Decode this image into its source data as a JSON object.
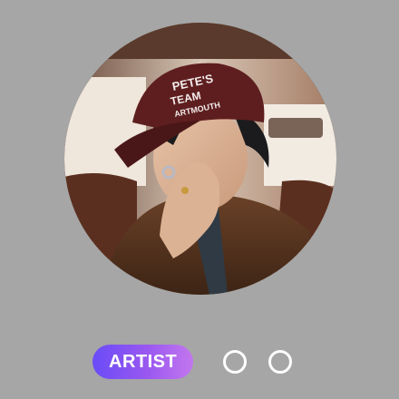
{
  "profile": {
    "avatar_alt": "",
    "cap_text": [
      "PETE'S",
      "TEAM",
      "ARTMOUTH"
    ]
  },
  "role_badge": {
    "label": "ARTIST",
    "colors": [
      "#6a4cf7",
      "#c377ee"
    ]
  },
  "pager": {
    "dots": [
      {
        "name": "dot-1"
      },
      {
        "name": "dot-2"
      }
    ]
  }
}
